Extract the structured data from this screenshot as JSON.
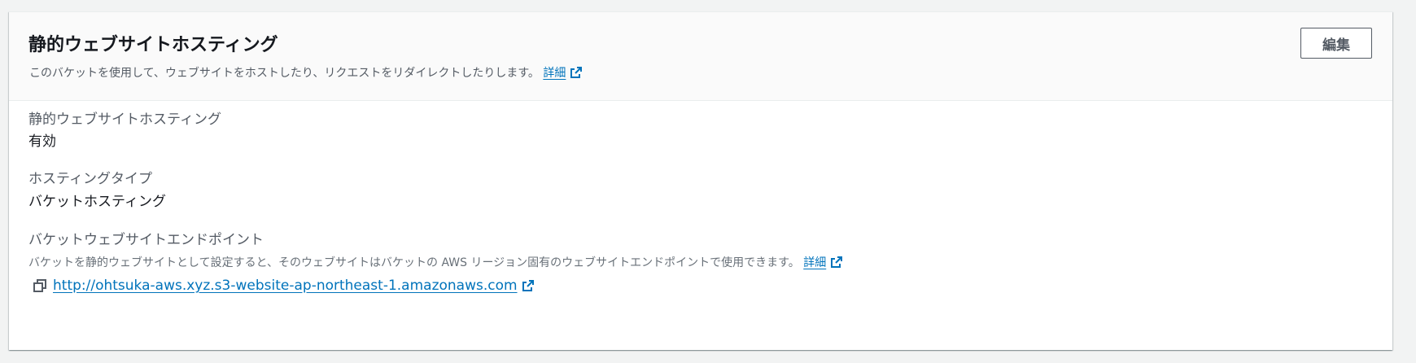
{
  "header": {
    "title": "静的ウェブサイトホスティング",
    "description": "このバケットを使用して、ウェブサイトをホストしたり、リクエストをリダイレクトしたりします。",
    "info_link": "詳細",
    "edit_button": "編集"
  },
  "fields": {
    "static_hosting": {
      "label": "静的ウェブサイトホスティング",
      "value": "有効"
    },
    "hosting_type": {
      "label": "ホスティングタイプ",
      "value": "バケットホスティング"
    },
    "endpoint": {
      "label": "バケットウェブサイトエンドポイント",
      "description": "バケットを静的ウェブサイトとして設定すると、そのウェブサイトはバケットの AWS リージョン固有のウェブサイトエンドポイントで使用できます。",
      "info_link": "詳細",
      "url": "http://ohtsuka-aws.xyz.s3-website-ap-northeast-1.amazonaws.com"
    }
  },
  "icons": {
    "external_link": "external-link-icon",
    "copy": "copy-icon"
  },
  "colors": {
    "link": "#0073bb",
    "text": "#16191f",
    "label": "#545b64",
    "header_bg": "#fafafa"
  }
}
